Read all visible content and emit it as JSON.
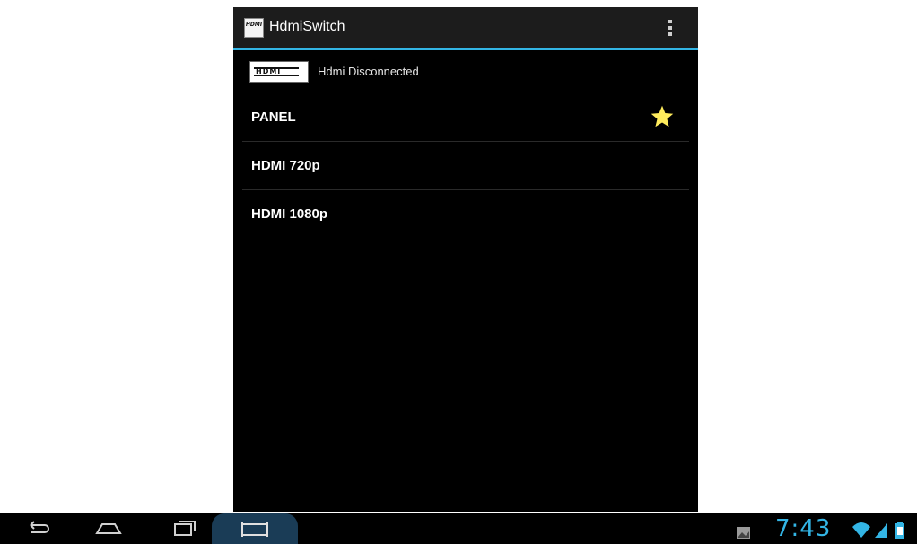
{
  "app": {
    "title": "HdmiSwitch",
    "icon_text": "HDMI",
    "icon": "hdmi-app-icon",
    "menu_icon": "overflow-menu-icon",
    "accent_color": "#33b5e5"
  },
  "status": {
    "logo_text": "HDMI",
    "text": "Hdmi Disconnected"
  },
  "modes": [
    {
      "label": "PANEL",
      "active": true,
      "icon": "star-icon"
    },
    {
      "label": "HDMI 720p",
      "active": false
    },
    {
      "label": "HDMI 1080p",
      "active": false
    }
  ],
  "star_color": "#ffec5c",
  "system_bar": {
    "buttons": [
      "back-icon",
      "home-icon",
      "recent-apps-icon",
      "screenshot-icon"
    ],
    "clock": "7:43",
    "status_icons": [
      "gallery-notification-icon",
      "wifi-icon",
      "signal-icon",
      "battery-icon"
    ]
  }
}
